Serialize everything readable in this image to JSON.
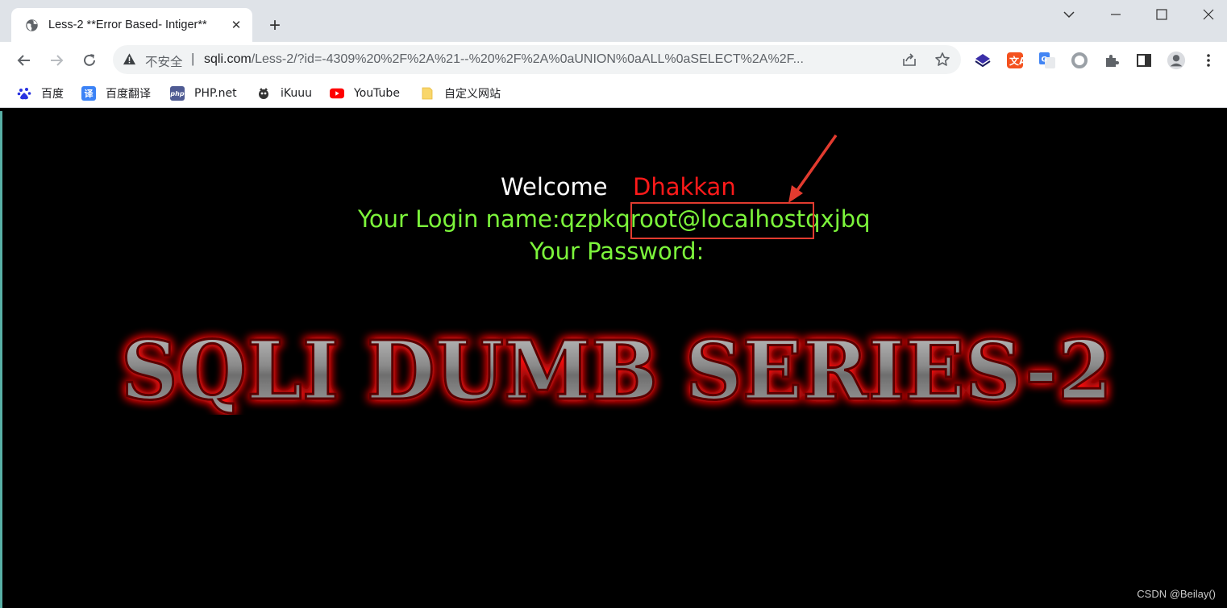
{
  "browser": {
    "tab": {
      "title": "Less-2 **Error Based- Intiger**"
    },
    "omnibox": {
      "security_label": "不安全",
      "separator": "|",
      "url_host": "sqli.com",
      "url_path": "/Less-2/?id=-4309%20%2F%2A%21--%20%2F%2A%0aUNION%0aALL%0aSELECT%2A%2F..."
    },
    "bookmarks": [
      {
        "label": "百度",
        "icon": "baidu-icon",
        "color": "#2932e1"
      },
      {
        "label": "百度翻译",
        "icon": "translate-icon",
        "color": "#3b82f6"
      },
      {
        "label": "PHP.net",
        "icon": "php-icon",
        "color": "#4f5b93"
      },
      {
        "label": "iKuuu",
        "icon": "ikuuu-icon",
        "color": "#333333"
      },
      {
        "label": "YouTube",
        "icon": "youtube-icon",
        "color": "#ff0000"
      },
      {
        "label": "自定义网站",
        "icon": "folder-icon",
        "color": "#f9d66b"
      }
    ]
  },
  "page": {
    "welcome": "Welcome",
    "name": "Dhakkan",
    "login_line": "Your Login name:qzpkqroot@localhostqxjbq",
    "password_line": "Your Password:",
    "banner": "SQLI DUMB SERIES-2",
    "watermark": "CSDN @Beilay()"
  },
  "colors": {
    "login_text": "#7cf53b",
    "name_text": "#ff1a1a",
    "highlight_box": "#e23b2f"
  }
}
